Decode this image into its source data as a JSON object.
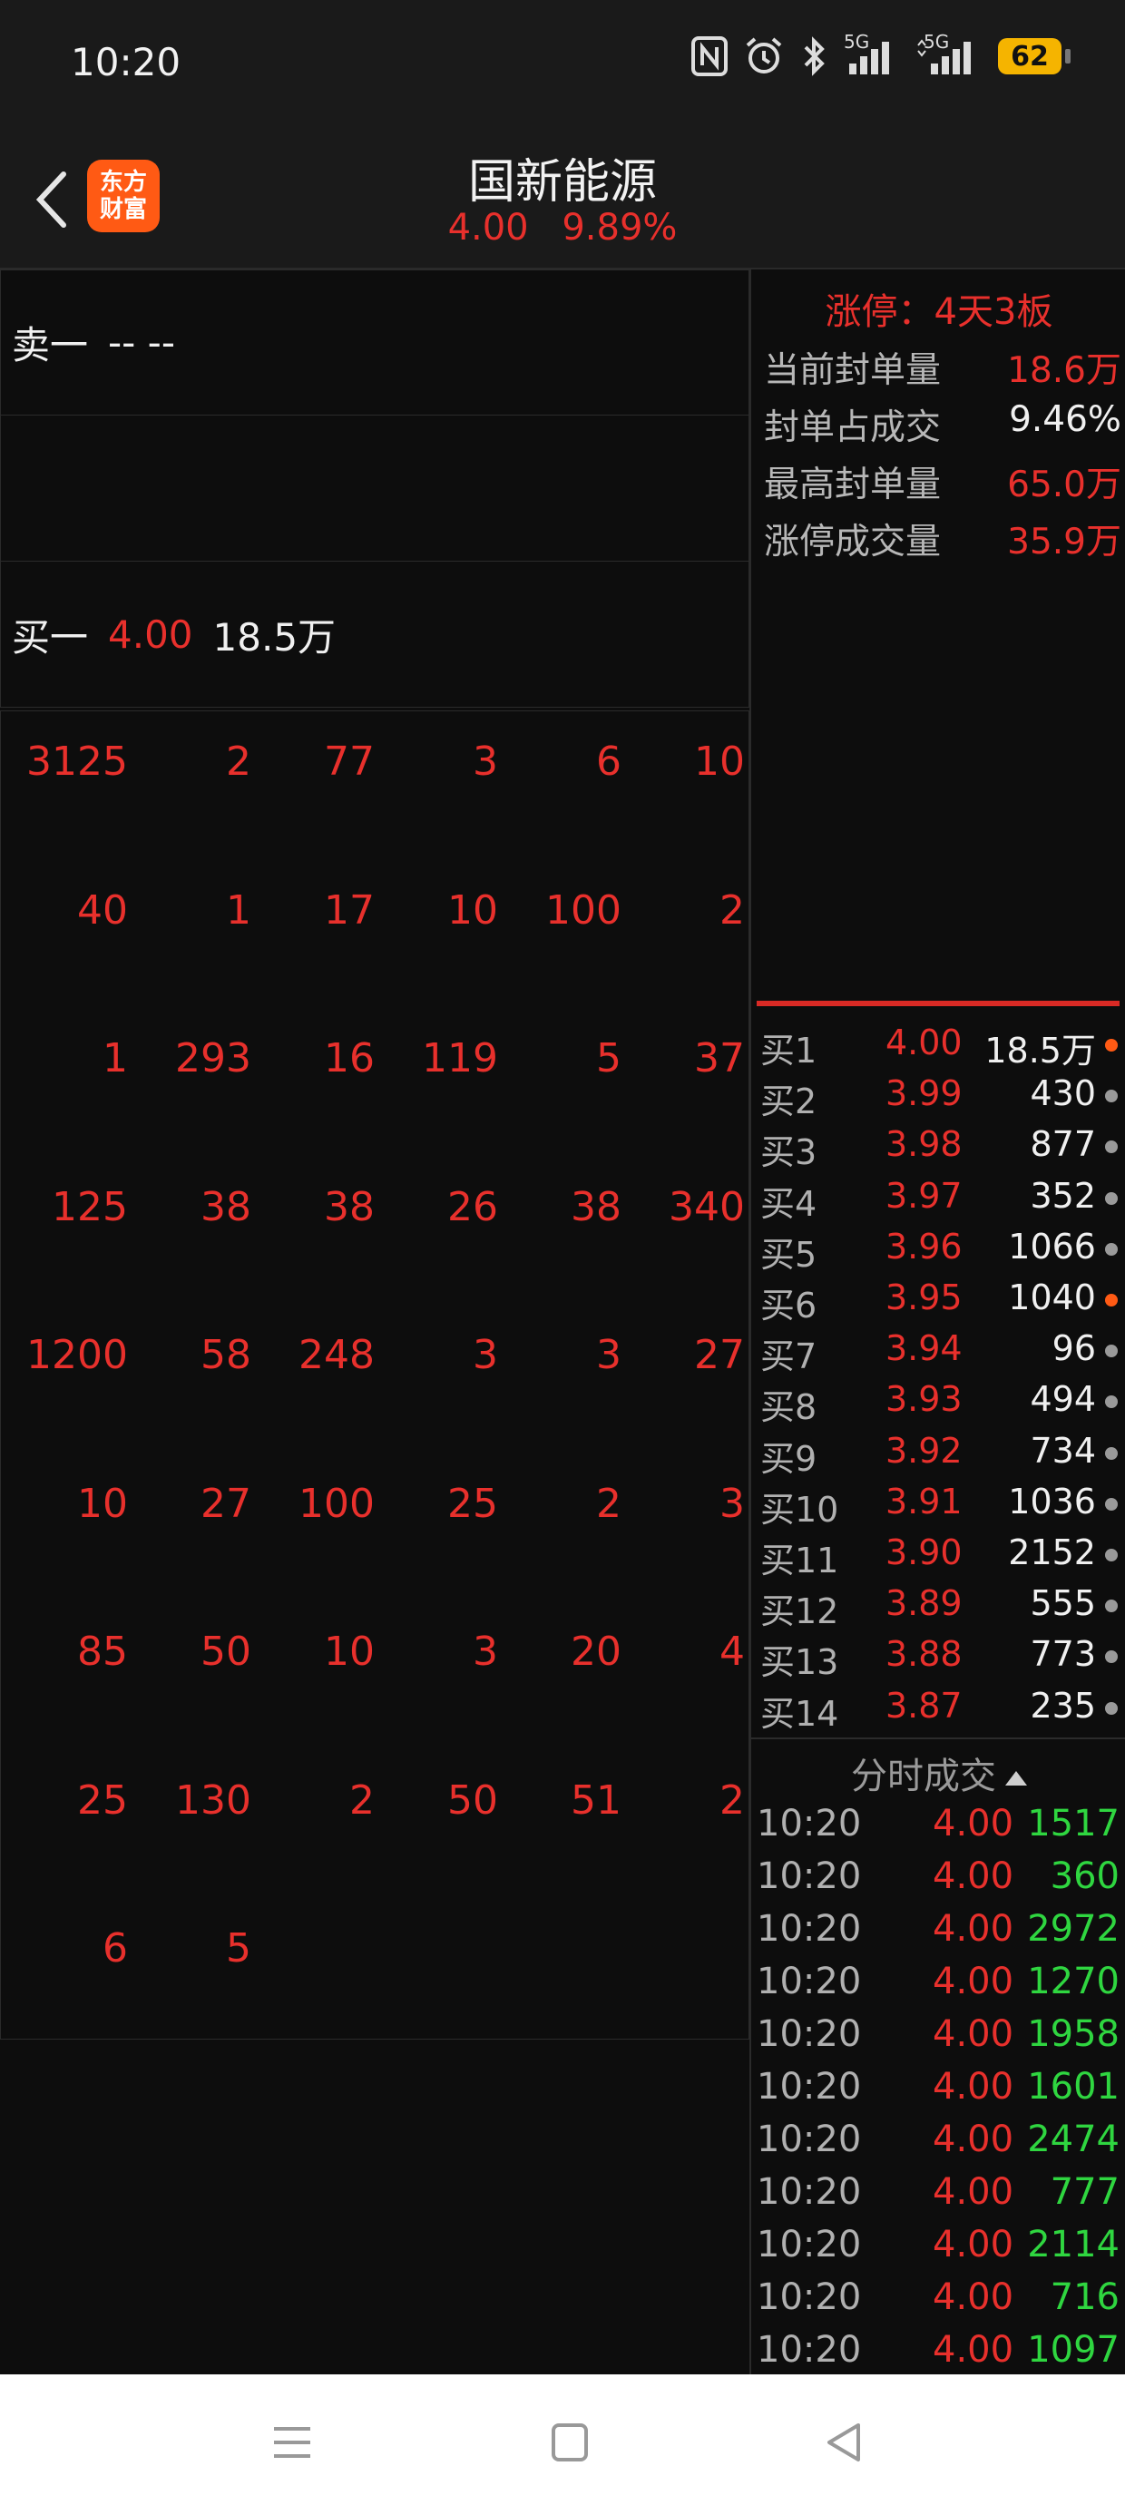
{
  "status": {
    "time": "10:20",
    "battery": "62",
    "signal1": "5G",
    "signal2": "5G"
  },
  "header": {
    "title": "国新能源",
    "price": "4.00",
    "change_pct": "9.89%",
    "logo_line1": "东方",
    "logo_line2": "财富"
  },
  "orderbook": {
    "sell1_label": "卖一",
    "sell1_value": "-- --",
    "buy1_label": "买一",
    "buy1_price": "4.00",
    "buy1_volume": "18.5万"
  },
  "queue": [
    [
      "3125",
      "2",
      "77",
      "3",
      "6",
      "10"
    ],
    [
      "40",
      "1",
      "17",
      "10",
      "100",
      "2"
    ],
    [
      "1",
      "293",
      "16",
      "119",
      "5",
      "37"
    ],
    [
      "125",
      "38",
      "38",
      "26",
      "38",
      "340"
    ],
    [
      "1200",
      "58",
      "248",
      "3",
      "3",
      "27"
    ],
    [
      "10",
      "27",
      "100",
      "25",
      "2",
      "3"
    ],
    [
      "85",
      "50",
      "10",
      "3",
      "20",
      "4"
    ],
    [
      "25",
      "130",
      "2",
      "50",
      "51",
      "2"
    ],
    [
      "6",
      "5"
    ]
  ],
  "limit_panel": {
    "title": "涨停：4天3板",
    "items": [
      {
        "label": "当前封单量",
        "value": "18.6万",
        "color": "red"
      },
      {
        "label": "封单占成交",
        "value": "9.46%",
        "color": "white"
      },
      {
        "label": "最高封单量",
        "value": "65.0万",
        "color": "red"
      },
      {
        "label": "涨停成交量",
        "value": "35.9万",
        "color": "red"
      }
    ]
  },
  "bids": [
    {
      "label": "买1",
      "price": "4.00",
      "volume": "18.5万",
      "dot": "orange"
    },
    {
      "label": "买2",
      "price": "3.99",
      "volume": "430",
      "dot": "gray"
    },
    {
      "label": "买3",
      "price": "3.98",
      "volume": "877",
      "dot": "gray"
    },
    {
      "label": "买4",
      "price": "3.97",
      "volume": "352",
      "dot": "gray"
    },
    {
      "label": "买5",
      "price": "3.96",
      "volume": "1066",
      "dot": "gray"
    },
    {
      "label": "买6",
      "price": "3.95",
      "volume": "1040",
      "dot": "orange"
    },
    {
      "label": "买7",
      "price": "3.94",
      "volume": "96",
      "dot": "gray"
    },
    {
      "label": "买8",
      "price": "3.93",
      "volume": "494",
      "dot": "gray"
    },
    {
      "label": "买9",
      "price": "3.92",
      "volume": "734",
      "dot": "gray"
    },
    {
      "label": "买10",
      "price": "3.91",
      "volume": "1036",
      "dot": "gray"
    },
    {
      "label": "买11",
      "price": "3.90",
      "volume": "2152",
      "dot": "gray"
    },
    {
      "label": "买12",
      "price": "3.89",
      "volume": "555",
      "dot": "gray"
    },
    {
      "label": "买13",
      "price": "3.88",
      "volume": "773",
      "dot": "gray"
    },
    {
      "label": "买14",
      "price": "3.87",
      "volume": "235",
      "dot": "gray"
    }
  ],
  "ticks_title": "分时成交",
  "ticks": [
    {
      "time": "10:20",
      "price": "4.00",
      "volume": "1517"
    },
    {
      "time": "10:20",
      "price": "4.00",
      "volume": "360"
    },
    {
      "time": "10:20",
      "price": "4.00",
      "volume": "2972"
    },
    {
      "time": "10:20",
      "price": "4.00",
      "volume": "1270"
    },
    {
      "time": "10:20",
      "price": "4.00",
      "volume": "1958"
    },
    {
      "time": "10:20",
      "price": "4.00",
      "volume": "1601"
    },
    {
      "time": "10:20",
      "price": "4.00",
      "volume": "2474"
    },
    {
      "time": "10:20",
      "price": "4.00",
      "volume": "777"
    },
    {
      "time": "10:20",
      "price": "4.00",
      "volume": "2114"
    },
    {
      "time": "10:20",
      "price": "4.00",
      "volume": "716"
    },
    {
      "time": "10:20",
      "price": "4.00",
      "volume": "1097"
    }
  ]
}
